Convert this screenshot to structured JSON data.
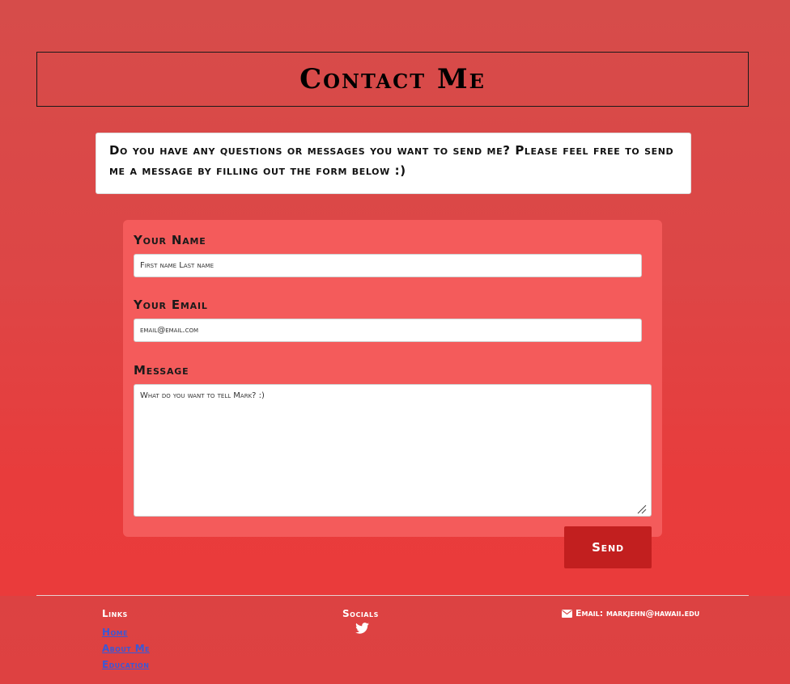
{
  "page": {
    "title": "Contact Me",
    "intro": "Do you have any questions or messages you want to send me? Please feel free to send me a message by filling out the form below :)"
  },
  "form": {
    "name_label": "Your Name",
    "name_placeholder": "First name Last name",
    "email_label": "Your Email",
    "email_placeholder": "email@email.com",
    "message_label": "Message",
    "message_placeholder": "What do you want to tell Mark? :)",
    "send_label": "Send"
  },
  "footer": {
    "links_title": "Links",
    "links": [
      "Home",
      "About Me",
      "Education"
    ],
    "socials_title": "Socials",
    "social_icons": [
      "twitter-icon"
    ],
    "email_text": "Email: markjehn@hawaii.edu",
    "email_icon": "envelope-icon"
  },
  "colors": {
    "background": "#e04444",
    "form_card": "#f45b5b",
    "send_button": "#c21f1f",
    "link": "#3a58d6"
  }
}
